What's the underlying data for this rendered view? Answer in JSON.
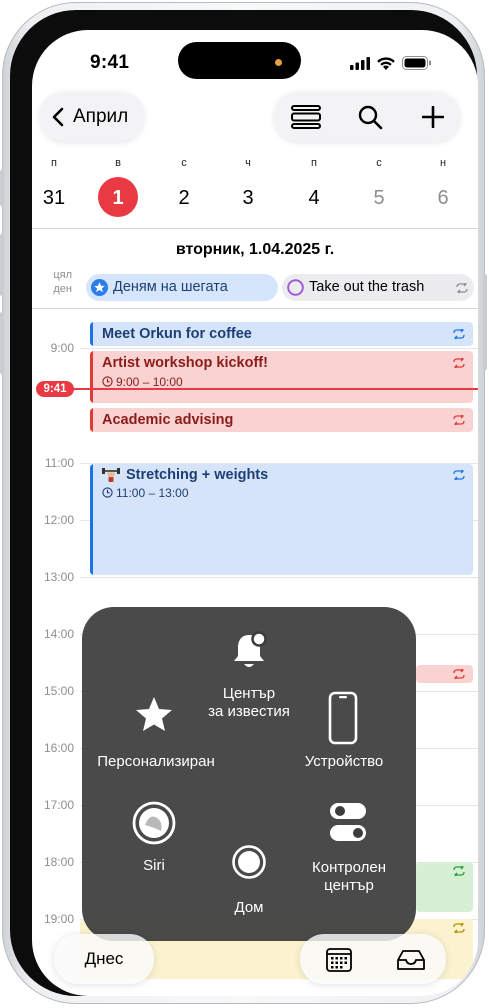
{
  "status_bar": {
    "time": "9:41"
  },
  "nav": {
    "back_label": "Април"
  },
  "week": {
    "weekdays": [
      "п",
      "в",
      "с",
      "ч",
      "п",
      "с",
      "н"
    ],
    "days": [
      "31",
      "1",
      "2",
      "3",
      "4",
      "5",
      "6"
    ]
  },
  "date_heading": "вторник, 1.04.2025 г.",
  "all_day": {
    "label_line1": "цял",
    "label_line2": "ден",
    "events": [
      {
        "title": "Деням на шегата"
      },
      {
        "title": "Take out the trash"
      }
    ]
  },
  "hours": [
    "9:00",
    "11:00",
    "12:00",
    "13:00",
    "14:00",
    "15:00",
    "16:00",
    "17:00",
    "18:00",
    "19:00"
  ],
  "now_badge": "9:41",
  "events": [
    {
      "title": "Meet Orkun for coffee"
    },
    {
      "title": "Artist workshop kickoff!",
      "time": "9:00 – 10:00"
    },
    {
      "title": "Academic advising"
    },
    {
      "title": "Stretching + weights",
      "time": "11:00 – 13:00"
    }
  ],
  "assistive_touch": {
    "notification_center_line1": "Център",
    "notification_center_line2": "за известия",
    "custom": "Персонализиран",
    "device": "Устройство",
    "siri": "Siri",
    "control_center_line1": "Контролен",
    "control_center_line2": "център",
    "home": "Дом"
  },
  "tab_bar": {
    "today": "Днес"
  },
  "colors": {
    "accent_red": "#e93a43",
    "event_blue": "#d6e4f9",
    "event_red": "#f9d3d2",
    "event_green": "#d6f0d6"
  }
}
